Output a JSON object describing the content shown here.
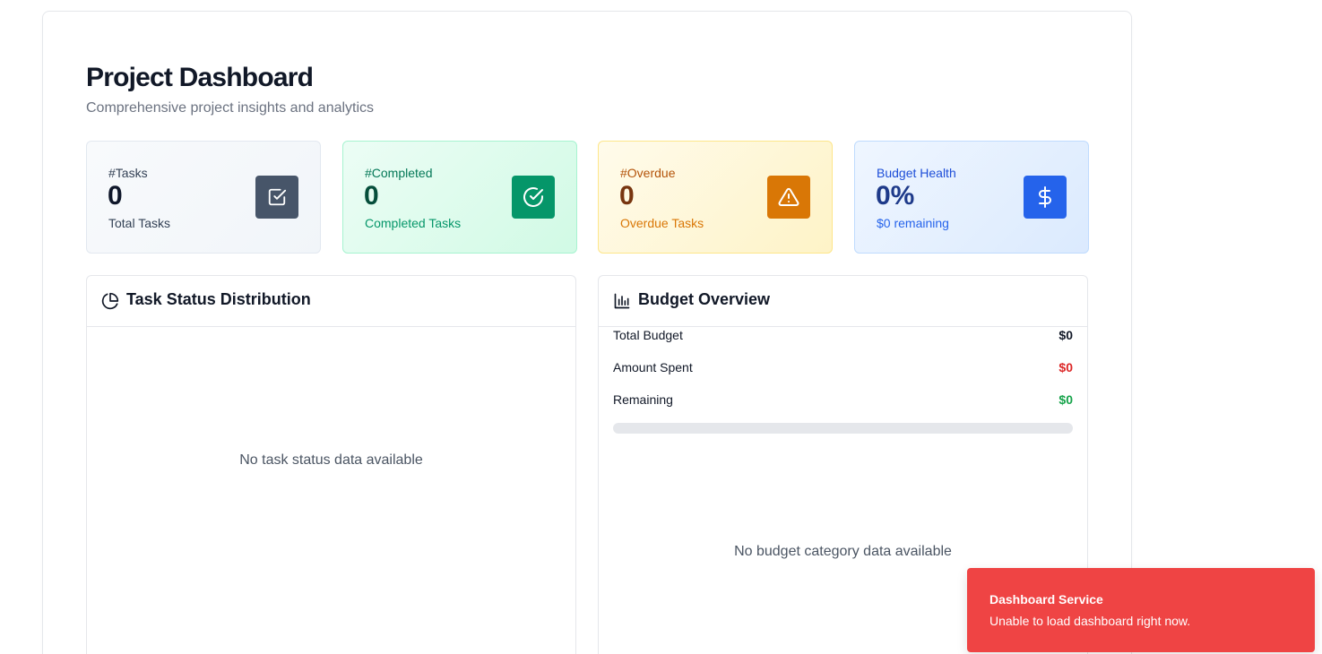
{
  "header": {
    "title": "Project Dashboard",
    "subtitle": "Comprehensive project insights and analytics"
  },
  "stats": [
    {
      "label": "#Tasks",
      "value": "0",
      "sub": "Total Tasks",
      "icon": "checkbox-icon"
    },
    {
      "label": "#Completed",
      "value": "0",
      "sub": "Completed Tasks",
      "icon": "check-circle-icon"
    },
    {
      "label": "#Overdue",
      "value": "0",
      "sub": "Overdue Tasks",
      "icon": "warning-icon"
    },
    {
      "label": "Budget Health",
      "value": "0%",
      "sub": "$0 remaining",
      "icon": "dollar-icon"
    }
  ],
  "task_status": {
    "title": "Task Status Distribution",
    "icon": "pie-chart-icon",
    "empty_message": "No task status data available"
  },
  "budget": {
    "title": "Budget Overview",
    "icon": "bar-chart-icon",
    "rows": [
      {
        "label": "Total Budget",
        "value": "$0",
        "color": "#111827"
      },
      {
        "label": "Amount Spent",
        "value": "$0",
        "color": "#dc2626"
      },
      {
        "label": "Remaining",
        "value": "$0",
        "color": "#16a34a"
      }
    ],
    "progress_percent": 0,
    "empty_message": "No budget category data available"
  },
  "toast": {
    "title": "Dashboard Service",
    "message": "Unable to load dashboard right now.",
    "color": "#ef4444"
  }
}
